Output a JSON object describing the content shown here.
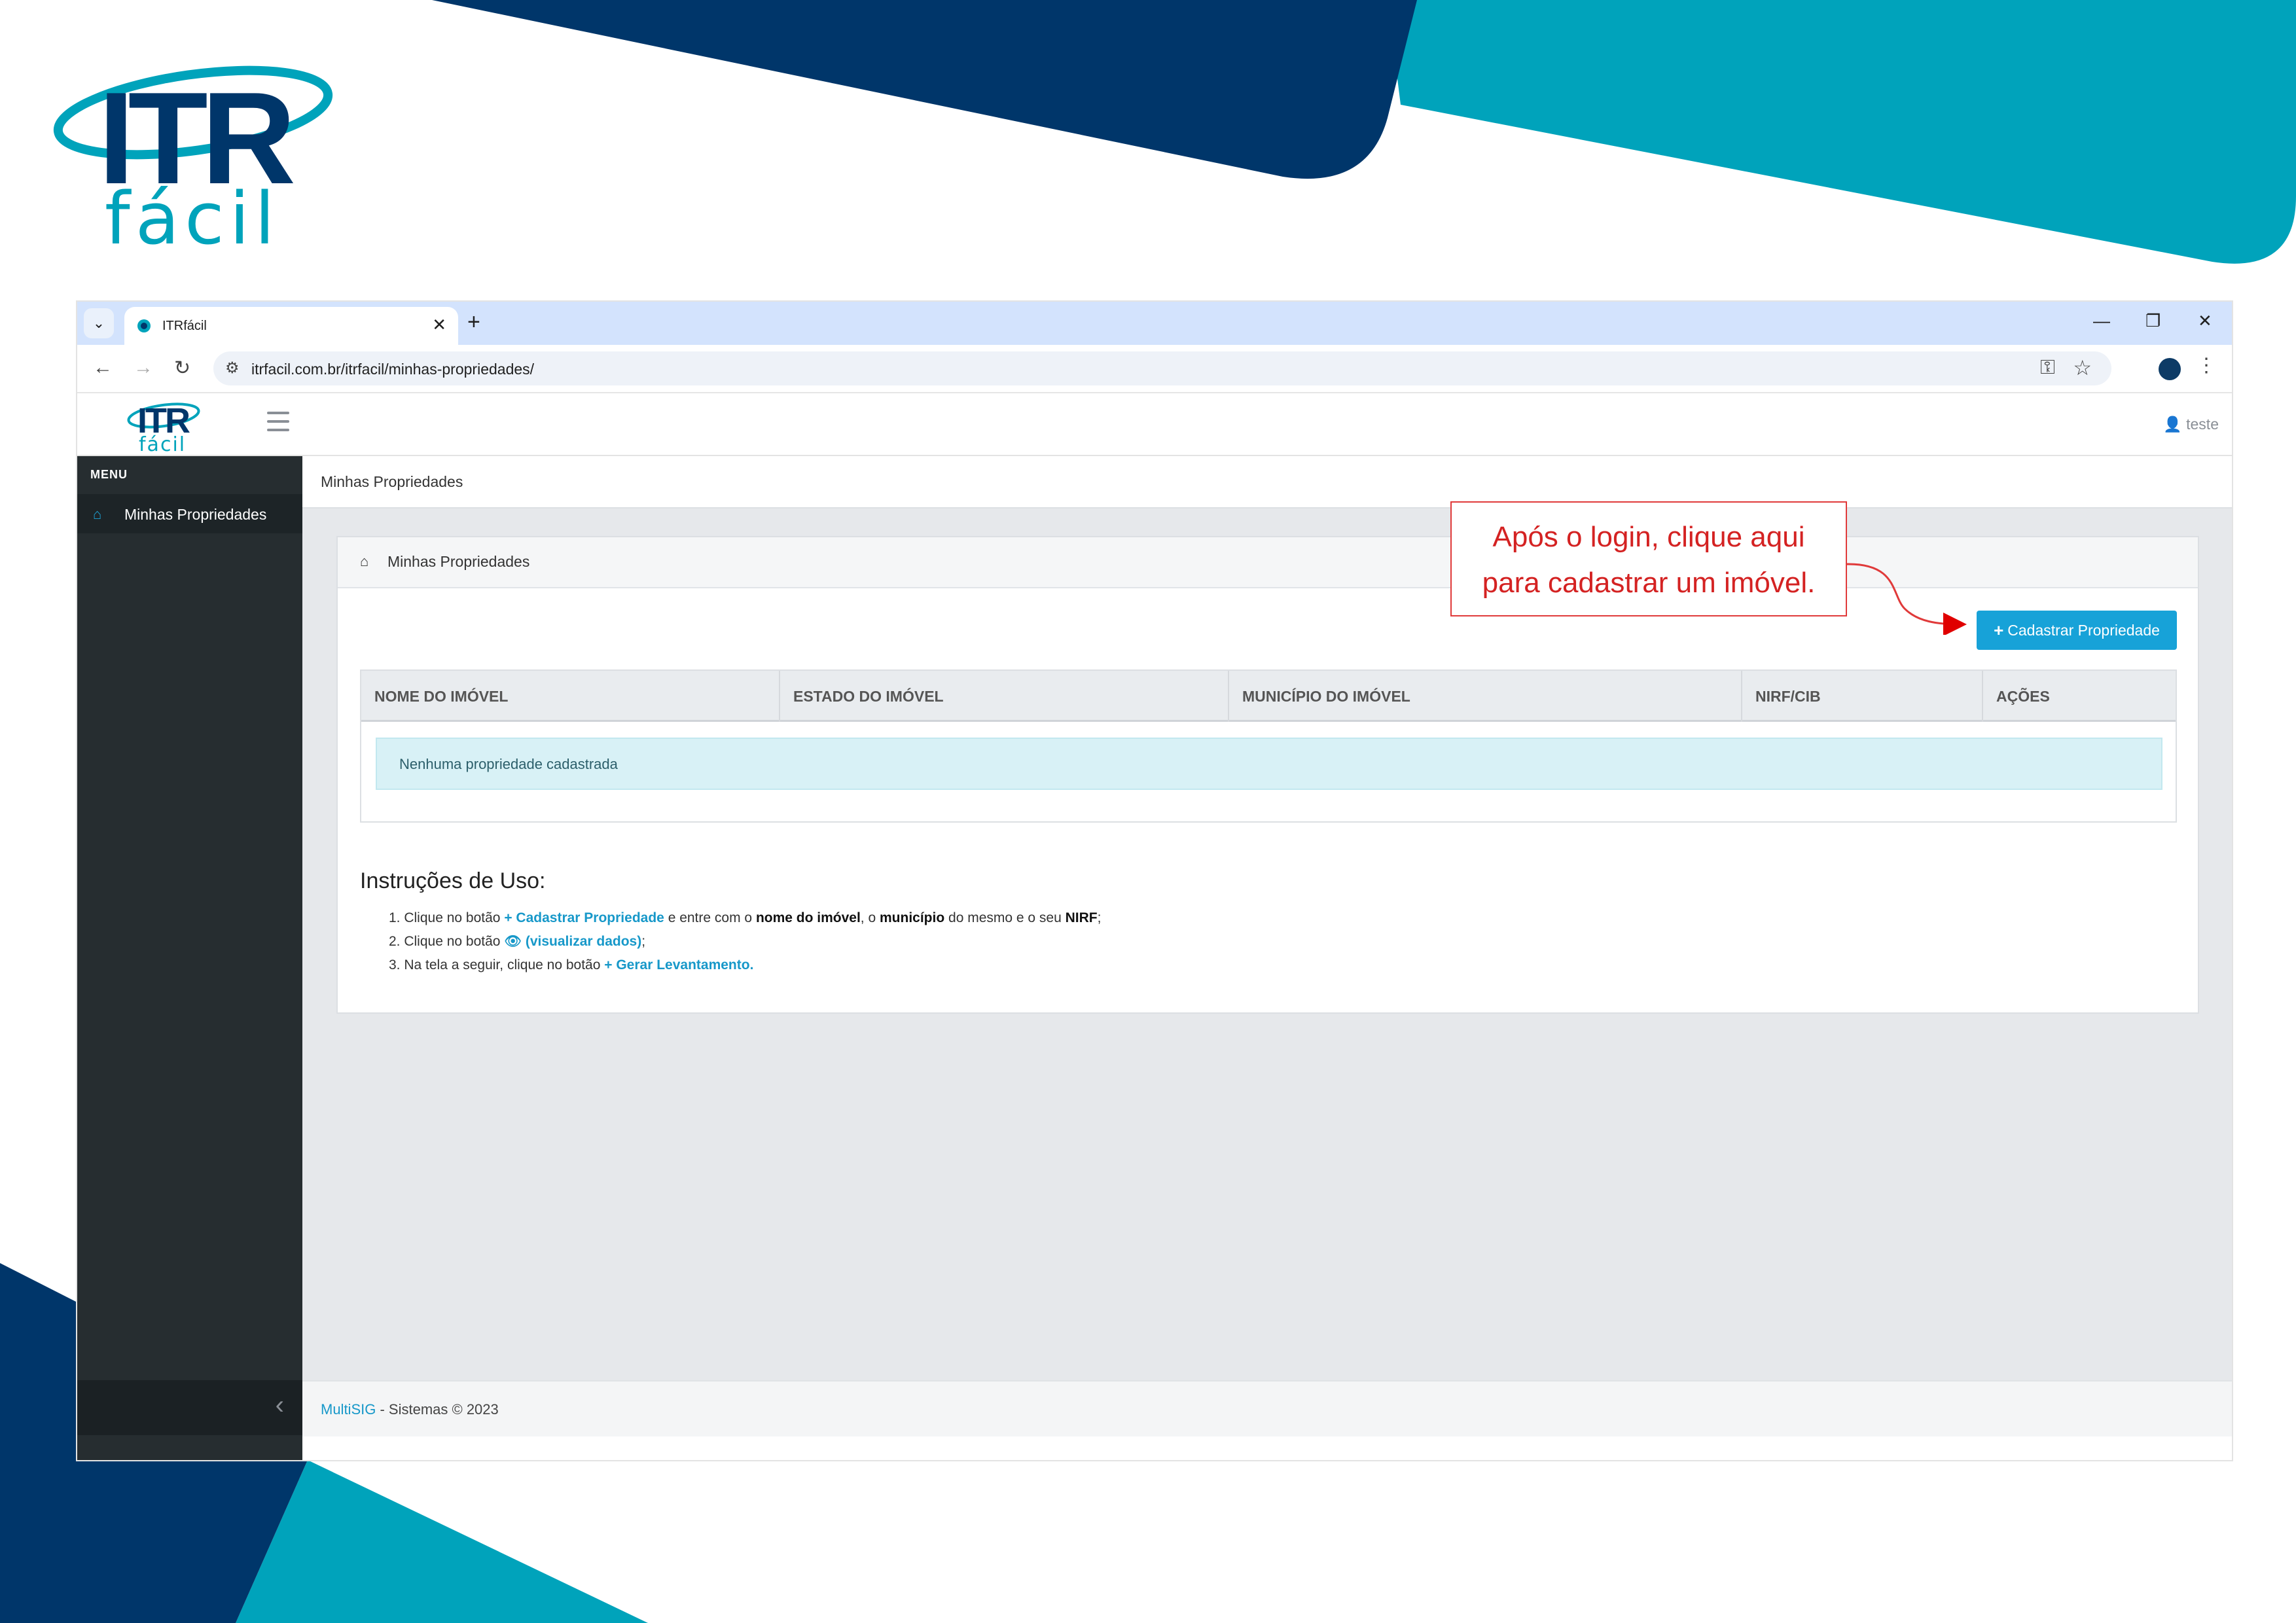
{
  "browser": {
    "tab_title": "ITRfácil",
    "tab_close": "✕",
    "new_tab": "+",
    "url": "itrfacil.com.br/itrfacil/minhas-propriedades/",
    "win_minimize": "—",
    "win_restore": "❐",
    "win_close": "✕"
  },
  "logo": {
    "itr": "ITR",
    "facil": "fácil"
  },
  "header": {
    "user": "teste"
  },
  "sidebar": {
    "menu_label": "MENU",
    "items": [
      {
        "label": "Minhas Propriedades",
        "icon": "home-icon"
      }
    ]
  },
  "main": {
    "breadcrumb": "Minhas Propriedades",
    "card_title": "Minhas Propriedades",
    "add_button": "Cadastrar Propriedade",
    "table": {
      "columns": [
        "NOME DO IMÓVEL",
        "ESTADO DO IMÓVEL",
        "MUNICÍPIO DO IMÓVEL",
        "NIRF/CIB",
        "AÇÕES"
      ],
      "empty_message": "Nenhuma propriedade cadastrada"
    },
    "instructions": {
      "title": "Instruções de Uso:",
      "line1": {
        "n": "1. Clique no botão",
        "link": "Cadastrar Propriedade",
        "t1": "e entre com o",
        "b1": "nome do imóvel",
        "t2": ", o",
        "b2": "município",
        "t3": "do mesmo e o seu",
        "b3": "NIRF",
        "t4": ";"
      },
      "line2": {
        "n": "2. Clique no botão",
        "link": "(visualizar dados)",
        "t1": ";"
      },
      "line3": {
        "n": "3. Na tela a seguir, clique no botão",
        "link": "Gerar Levantamento",
        "t1": "."
      }
    }
  },
  "footer": {
    "brand": "MultiSIG",
    "text": " - Sistemas © 2023"
  },
  "annotation": {
    "line1": "Após o login, clique aqui",
    "line2": "para cadastrar um imóvel."
  },
  "colors": {
    "navy": "#00366a",
    "teal": "#00a3bb",
    "accent": "#17a2d8",
    "callout_red": "#d42222"
  }
}
